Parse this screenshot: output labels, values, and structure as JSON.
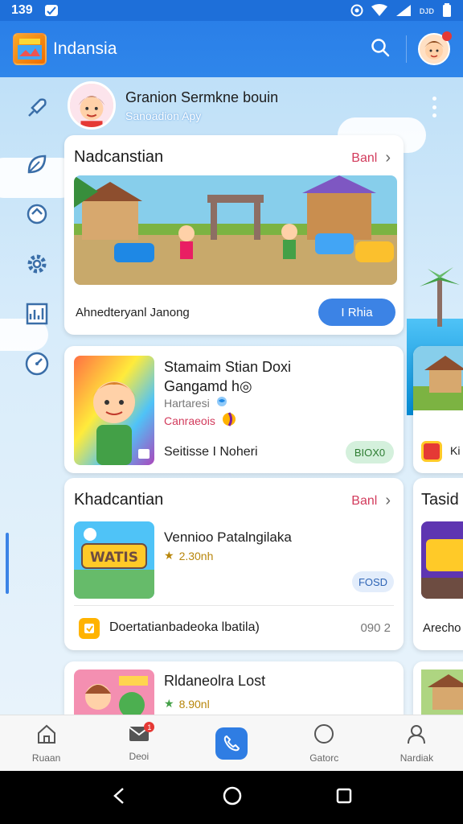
{
  "status_bar": {
    "time": "139",
    "battery": "ᴅᴊᴅ"
  },
  "app_bar": {
    "title": "Indansia"
  },
  "profile": {
    "name": "Granion Sermkne bouin",
    "subtitle": "Sanoadion Apy"
  },
  "featured_card": {
    "title": "Nadcanstian",
    "link_label": "Banl",
    "caption": "Ahnedteryanl Janong",
    "action_label": "I Rhia"
  },
  "game_card": {
    "title_line1": "Stamaim Stian Doxi",
    "title_line2": "Gangamd h◎",
    "meta_line1": "Hartaresi",
    "meta_line2": "Canraeois",
    "footer_label": "Seitisse I Noheri",
    "tag": "BIOX0"
  },
  "section_card": {
    "title": "Khadcantian",
    "link_label": "Banl",
    "item_title": "Vennioo Patalngilaka",
    "item_rating": "2.30nh",
    "item_tag": "FOSD",
    "thumb_text": "WATIS",
    "list_text": "Doertatianbadeoka lbatila)",
    "list_count": "090 2"
  },
  "bottom_card": {
    "title": "Rldaneolra Lost",
    "rating": "8.90nl"
  },
  "right_peek": {
    "label_a": "Tasid",
    "label_b": "Arecho",
    "label_c": "Ki"
  },
  "bottom_nav": {
    "items": [
      {
        "label": "Ruaan",
        "icon": "home-icon"
      },
      {
        "label": "Deoi",
        "icon": "mail-icon",
        "badge": "1"
      },
      {
        "label": "",
        "icon": "phone-icon"
      },
      {
        "label": "Gatorc",
        "icon": "circle-icon"
      },
      {
        "label": "Nardiak",
        "icon": "person-icon"
      }
    ]
  },
  "colors": {
    "primary": "#2a7fe8",
    "accent": "#d23b5c",
    "badge": "#e53935"
  }
}
